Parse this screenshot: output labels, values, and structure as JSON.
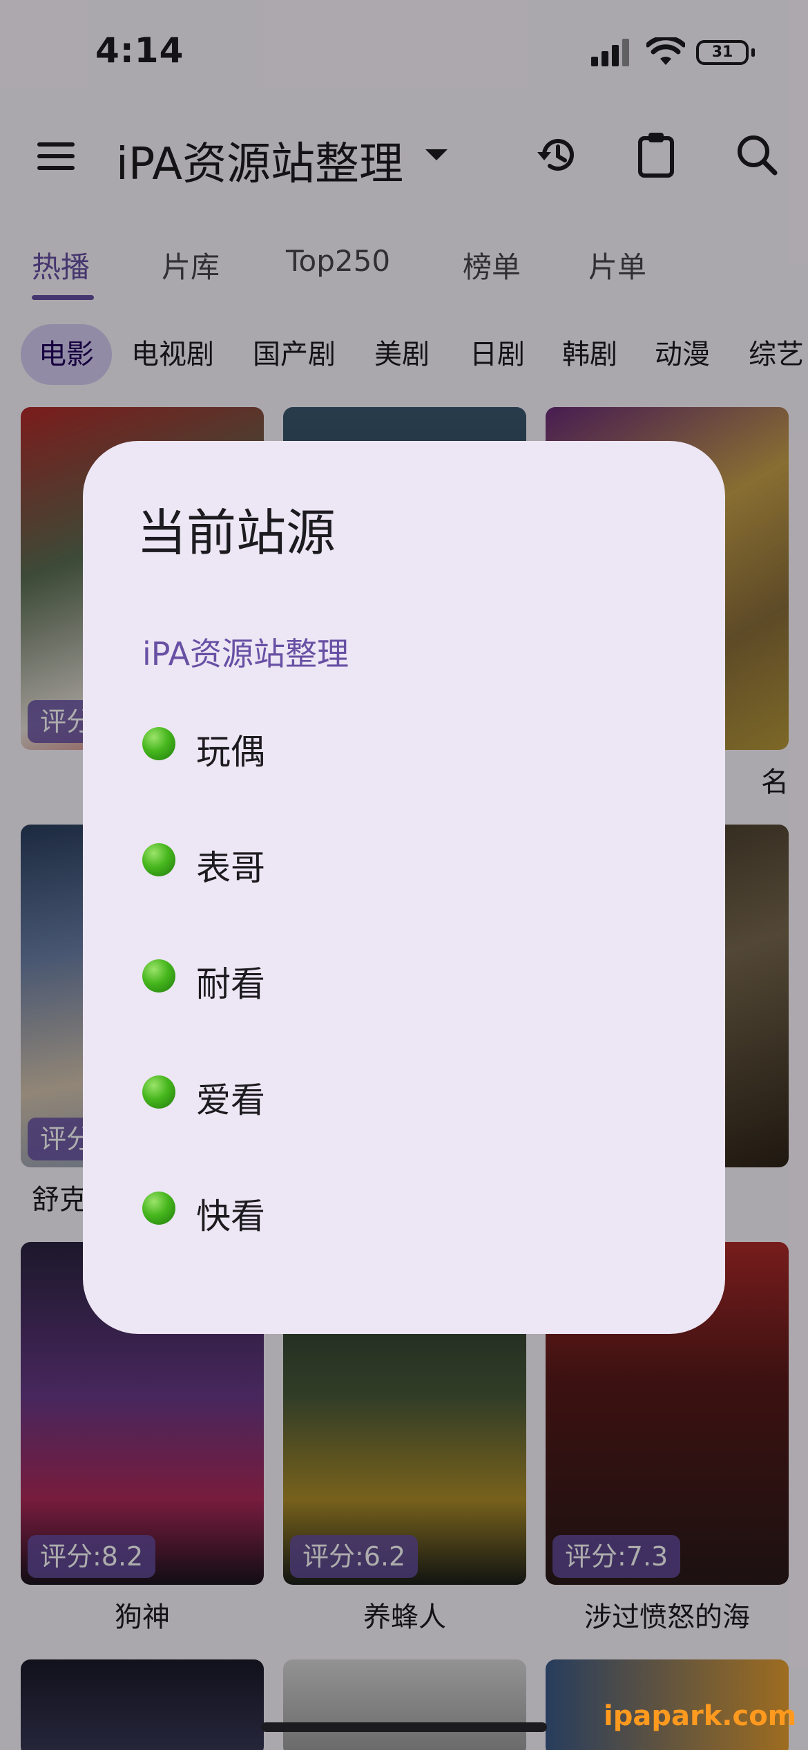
{
  "status_bar": {
    "time": "4:14",
    "battery": "31"
  },
  "app_bar": {
    "title": "iPA资源站整理"
  },
  "tabs": [
    {
      "label": "热播",
      "active": true
    },
    {
      "label": "片库",
      "active": false
    },
    {
      "label": "Top250",
      "active": false
    },
    {
      "label": "榜单",
      "active": false
    },
    {
      "label": "片单",
      "active": false
    }
  ],
  "chips": [
    {
      "label": "电影",
      "active": true
    },
    {
      "label": "电视剧"
    },
    {
      "label": "国产剧"
    },
    {
      "label": "美剧"
    },
    {
      "label": "日剧"
    },
    {
      "label": "韩剧"
    },
    {
      "label": "动漫"
    },
    {
      "label": "综艺"
    }
  ],
  "movies": [
    {
      "title": "",
      "rating": "评分"
    },
    {
      "title": "",
      "rating": ""
    },
    {
      "title": "名",
      "rating": ""
    },
    {
      "title": "舒克",
      "rating": "评分"
    },
    {
      "title": "",
      "rating": ""
    },
    {
      "title": "",
      "rating": ""
    },
    {
      "title": "狗神",
      "rating": "评分:8.2"
    },
    {
      "title": "养蜂人",
      "rating": "评分:6.2"
    },
    {
      "title": "涉过愤怒的海",
      "rating": "评分:7.3"
    }
  ],
  "dialog": {
    "title": "当前站源",
    "current_source": "iPA资源站整理",
    "sources": [
      {
        "label": "玩偶"
      },
      {
        "label": "表哥"
      },
      {
        "label": "耐看"
      },
      {
        "label": "爱看"
      },
      {
        "label": "快看"
      }
    ]
  },
  "watermark": "ipapark.com",
  "colors": {
    "accent": "#6750a4",
    "dialog_bg": "#ede6f4",
    "status_dot": "#46b61d"
  }
}
